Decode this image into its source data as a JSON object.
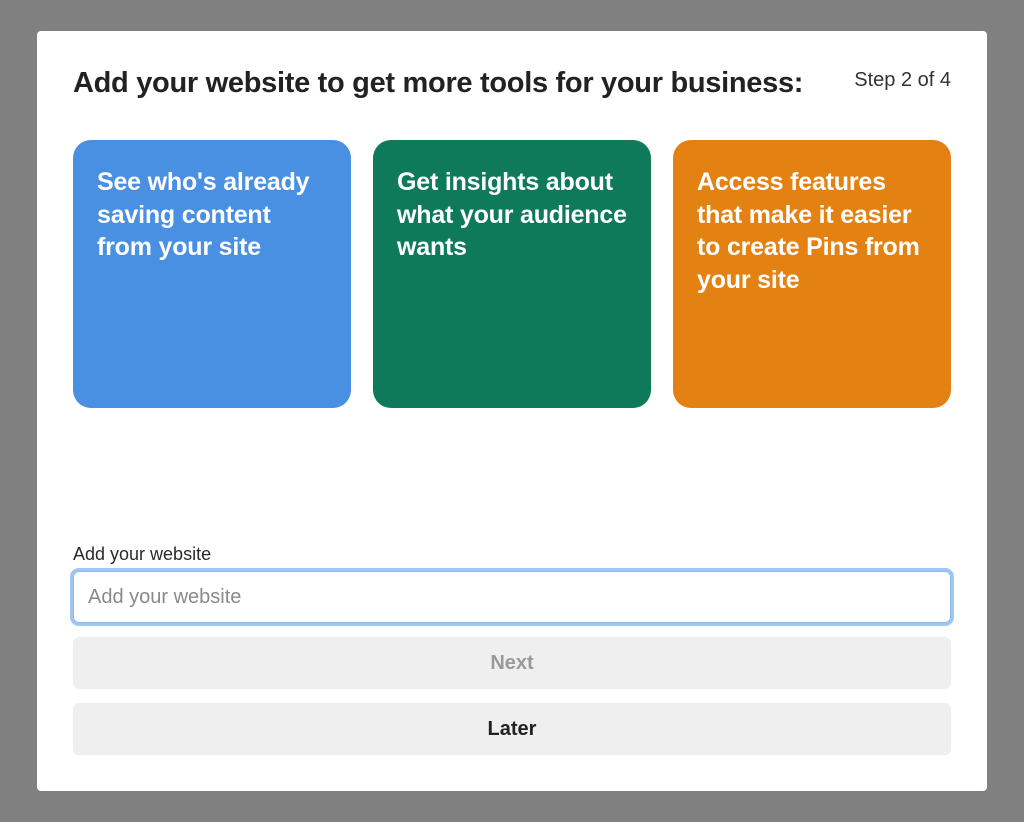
{
  "header": {
    "title": "Add your website to get more tools for your business:",
    "step_text": "Step 2 of 4"
  },
  "cards": [
    {
      "text": "See who's already saving content from your site"
    },
    {
      "text": "Get insights about what your audience wants"
    },
    {
      "text": "Access features that make it easier to create Pins from your site"
    }
  ],
  "form": {
    "label": "Add your website",
    "placeholder": "Add your website",
    "value": ""
  },
  "buttons": {
    "next": "Next",
    "later": "Later"
  },
  "colors": {
    "card_blue": "#4a90e2",
    "card_green": "#0f7a5a",
    "card_orange": "#e38213",
    "button_bg": "#efefef",
    "input_focus_ring": "#5ca0e9"
  }
}
